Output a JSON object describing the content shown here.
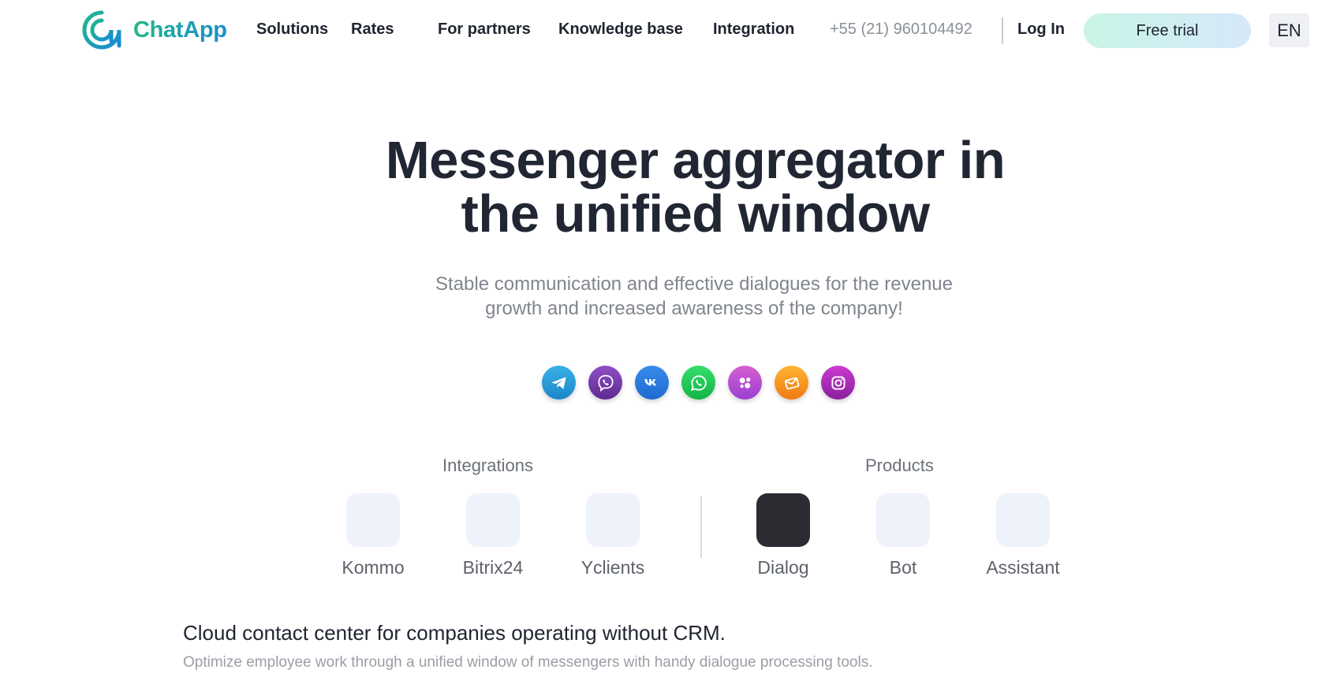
{
  "header": {
    "logo_text": "ChatApp",
    "nav": [
      "Solutions",
      "Rates",
      "For partners",
      "Knowledge base",
      "Integration"
    ],
    "phone": "+55 (21) 960104492",
    "login": "Log In",
    "cta": "Free trial",
    "language": "EN"
  },
  "hero": {
    "title_line1": "Messenger aggregator in",
    "title_line2": "the unified window",
    "subtitle": "Stable communication and effective dialogues for the revenue growth and increased awareness of the company!"
  },
  "socials": [
    "telegram-icon",
    "viber-icon",
    "vk-icon",
    "whatsapp-icon",
    "bubbles-icon",
    "email-icon",
    "instagram-icon"
  ],
  "integrations": {
    "label": "Integrations",
    "items": [
      "Kommo",
      "Bitrix24",
      "Yclients"
    ]
  },
  "products": {
    "label": "Products",
    "items": [
      "Dialog",
      "Bot",
      "Assistant"
    ],
    "selected": "Dialog"
  },
  "description": {
    "title": "Cloud contact center for companies operating without CRM.",
    "text": "Optimize employee work through a unified window of messengers with handy dialogue processing tools."
  },
  "colors": {
    "brand_green": "#22b58a",
    "brand_blue": "#1a8fd0",
    "text_dark": "#212633",
    "tile_bg": "#eef2fb",
    "tile_active": "#2b2c31"
  }
}
